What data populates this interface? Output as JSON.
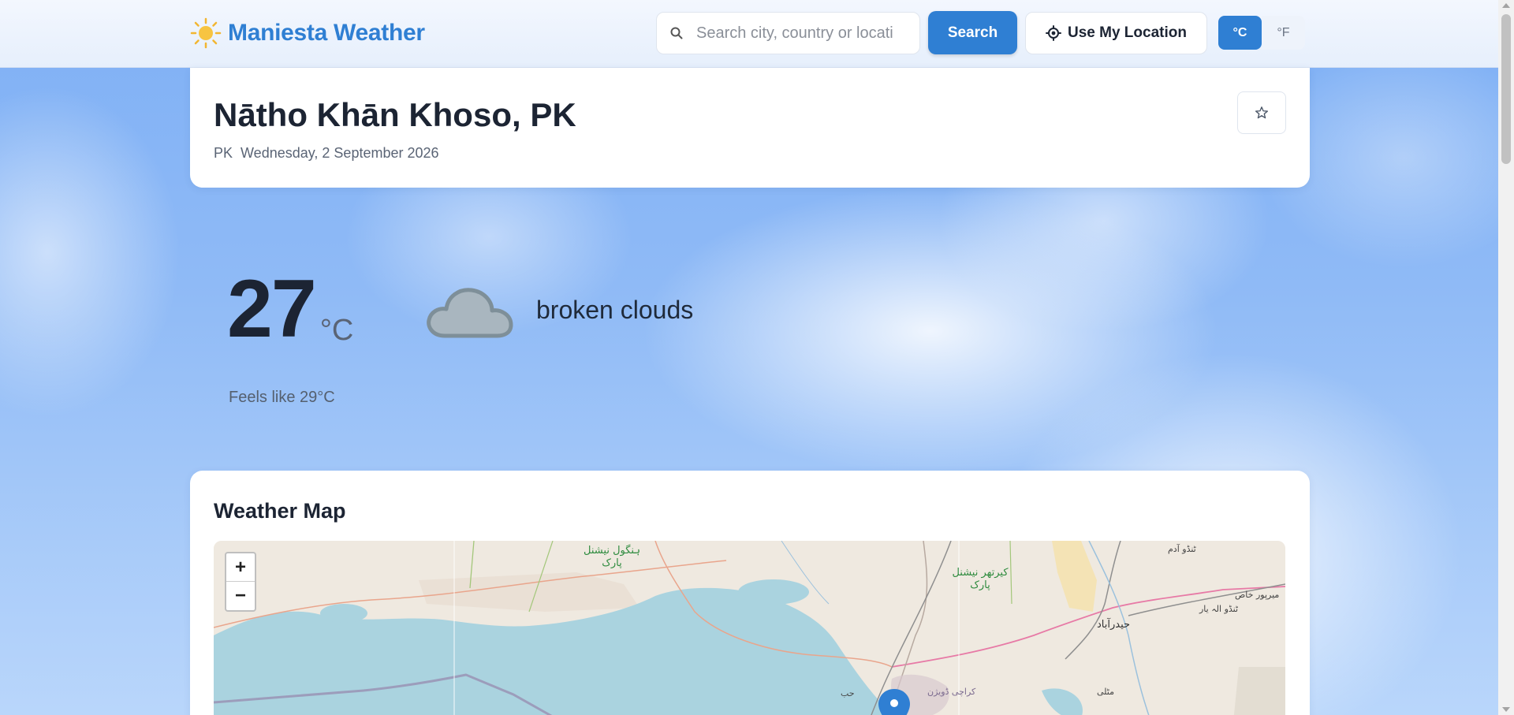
{
  "header": {
    "brand": "Maniesta Weather",
    "logo_icon": "sun-icon",
    "search_placeholder": "Search city, country or location",
    "search_button": "Search",
    "location_button": "Use My Location",
    "unit_celsius": "°C",
    "unit_fahrenheit": "°F",
    "active_unit": "°C"
  },
  "location": {
    "name": "Nātho Khān Khoso, PK",
    "country_code": "PK",
    "date": "Wednesday, 2 September 2026",
    "favorite_icon": "star-icon"
  },
  "current": {
    "temperature": "27",
    "unit": "°C",
    "condition": "broken clouds",
    "condition_icon": "cloud-icon",
    "feels_like": "Feels like 29°C"
  },
  "map": {
    "title": "Weather Map",
    "zoom_in": "+",
    "zoom_out": "−",
    "labels": {
      "park1_line1": "ہنگول نیشنل",
      "park1_line2": "پارک",
      "park2_line1": "کیرتھر نیشنل",
      "park2_line2": "پارک",
      "city1": "ٹنڈو آدم",
      "city2": "حیدرآباد",
      "city3": "میرپور خاص",
      "city4": "ٹنڈو الہ یار",
      "city5": "کراچی ڈویژن",
      "city6": "حب",
      "city7": "مٹلی"
    }
  },
  "colors": {
    "brand": "#2f7fd3",
    "water": "#aad3df",
    "land": "#efe9e0"
  }
}
